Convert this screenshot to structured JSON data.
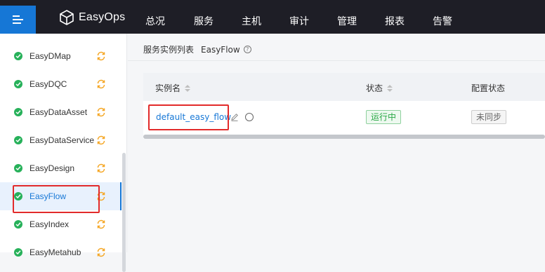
{
  "topbar": {
    "brand": "EasyOps",
    "nav": [
      {
        "label": "总况"
      },
      {
        "label": "服务"
      },
      {
        "label": "主机"
      },
      {
        "label": "审计"
      },
      {
        "label": "管理"
      },
      {
        "label": "报表"
      },
      {
        "label": "告警"
      }
    ]
  },
  "sidebar": {
    "items": [
      {
        "label": "EasyDMap",
        "status_icon": "check-circle-icon",
        "action_icon": "sync-icon"
      },
      {
        "label": "EasyDQC",
        "status_icon": "check-circle-icon",
        "action_icon": "sync-icon"
      },
      {
        "label": "EasyDataAsset",
        "status_icon": "check-circle-icon",
        "action_icon": "sync-icon"
      },
      {
        "label": "EasyDataService",
        "status_icon": "check-circle-icon",
        "action_icon": "sync-icon"
      },
      {
        "label": "EasyDesign",
        "status_icon": "check-circle-icon",
        "action_icon": "sync-icon"
      },
      {
        "label": "EasyFlow",
        "status_icon": "check-circle-icon",
        "action_icon": "sync-icon",
        "active": true
      },
      {
        "label": "EasyIndex",
        "status_icon": "check-circle-icon",
        "action_icon": "sync-icon"
      },
      {
        "label": "EasyMetahub",
        "status_icon": "check-circle-icon",
        "action_icon": "sync-icon"
      }
    ]
  },
  "breadcrumb": {
    "parent": "服务实例列表",
    "current": "EasyFlow",
    "help_icon": "question-circle-icon"
  },
  "table": {
    "columns": [
      {
        "label": "实例名",
        "sortable": true
      },
      {
        "label": "状态",
        "sortable": true
      },
      {
        "label": "配置状态",
        "sortable": false
      }
    ],
    "rows": [
      {
        "instance_name": "default_easy_flow",
        "status": "运行中",
        "config_status": "未同步"
      }
    ]
  },
  "colors": {
    "topbar_bg": "#1e1e26",
    "accent": "#1677d6",
    "running_green": "#28a745",
    "highlight_red": "#e22b2b"
  }
}
